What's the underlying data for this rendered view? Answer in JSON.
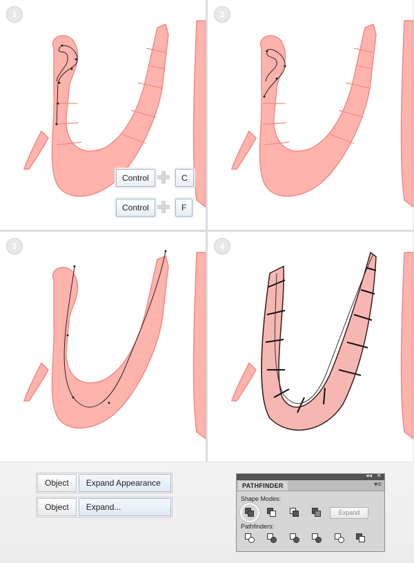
{
  "steps": [
    {
      "number": "1",
      "shortcuts": [
        {
          "mod": "Control",
          "key": "C"
        },
        {
          "mod": "Control",
          "key": "F"
        }
      ]
    },
    {
      "number": "2"
    },
    {
      "number": "3"
    },
    {
      "number": "4"
    }
  ],
  "menus": [
    {
      "first": "Object",
      "second": "Expand Appearance"
    },
    {
      "first": "Object",
      "second": "Expand..."
    }
  ],
  "pathfinder": {
    "title": "PATHFINDER",
    "shape_modes_label": "Shape Modes:",
    "pathfinders_label": "Pathfinders:",
    "expand_label": "Expand",
    "shape_mode_icons": [
      "unite-icon",
      "minus-front-icon",
      "intersect-icon",
      "exclude-icon"
    ],
    "pathfinder_icons": [
      "divide-icon",
      "trim-icon",
      "merge-icon",
      "crop-icon",
      "outline-icon",
      "minus-back-icon"
    ]
  },
  "colors": {
    "worm": "#ffb3ad",
    "worm_stroke": "#f08a86",
    "path": "#222222"
  }
}
